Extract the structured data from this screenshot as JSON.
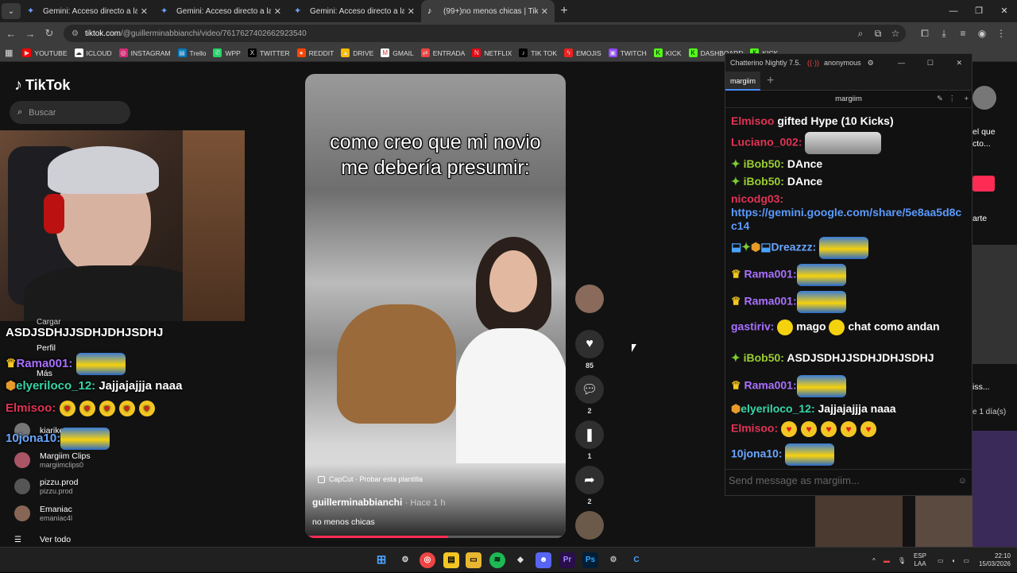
{
  "browser": {
    "tabs": [
      {
        "label": "Gemini: Acceso directo a la IA c",
        "icon": "gemini-icon"
      },
      {
        "label": "Gemini: Acceso directo a la IA c",
        "icon": "gemini-icon"
      },
      {
        "label": "Gemini: Acceso directo a la IA c",
        "icon": "gemini-icon"
      },
      {
        "label": "(99+)no menos chicas | TikTok",
        "icon": "tiktok-icon"
      }
    ],
    "url_domain": "tiktok.com",
    "url_path": "/@guillerminabbianchi/video/7617627402662923540",
    "bookmarks": [
      "YOUTUBE",
      "ICLOUD",
      "INSTAGRAM",
      "Trello",
      "WPP",
      "TWITTER",
      "REDDIT",
      "DRIVE",
      "GMAIL",
      "ENTRADA",
      "NETFLIX",
      "TIK TOK",
      "EMOJIS",
      "TWITCH",
      "KICK",
      "DASHBOARD",
      "KICK"
    ],
    "accent": "#4a8cff"
  },
  "tiktok": {
    "logo": "TikTok",
    "search_placeholder": "Buscar",
    "video": {
      "caption_line1": "como creo que mi novio",
      "caption_line2": "me debería presumir:",
      "capcut": "CapCut · Probar esta plantilla",
      "author": "guillerminabbianchi",
      "time": "· Hace 1 h",
      "description": "no menos chicas",
      "progress": 0.55
    },
    "actions": {
      "likes": "85",
      "comments": "2",
      "saves": "1",
      "shares": "2"
    },
    "sidebar": {
      "cargar": "Cargar",
      "perfil": "Perfil",
      "mas": "Más",
      "following": [
        {
          "name": "kiarike",
          "handle": ""
        },
        {
          "name": "Margiim Clips",
          "handle": "margiimclips0"
        },
        {
          "name": "pizzu.prod",
          "handle": "pizzu.prod"
        },
        {
          "name": "Emaniac",
          "handle": "emaniac4l"
        }
      ],
      "ver_todo": "Ver todo"
    },
    "overlay_chat": [
      {
        "user": "",
        "text": "ASDJSDHJJSDHJDHJSDHJ",
        "color": "#ffffff"
      },
      {
        "user": "Rama001:",
        "text": "",
        "color": "#a970ff"
      },
      {
        "user": "elyeriloco_12:",
        "text": "Jajjajajjja naaa",
        "color": "#36d6a8"
      },
      {
        "user": "Elmisoo:",
        "text": "",
        "color": "#e03355"
      },
      {
        "user": "10jona10:",
        "text": "",
        "color": "#6aa6ff"
      }
    ]
  },
  "chatterino": {
    "title": "Chatterino Nightly 7.5.",
    "account": "anonymous",
    "tab": "margiim",
    "channel": "margiim",
    "messages": [
      {
        "user": "Elmisoo",
        "text": "gifted Hype (10 Kicks)",
        "color": "#e03355"
      },
      {
        "user": "Luciano_002:",
        "text": "",
        "color": "#e03355"
      },
      {
        "user": "iBob50:",
        "text": "DAnce",
        "color": "#9acd32"
      },
      {
        "user": "iBob50:",
        "text": "DAnce",
        "color": "#9acd32"
      },
      {
        "user": "nicodg03:",
        "text": "https://gemini.google.com/share/5e8aa5d8cc14",
        "color": "#e03355"
      },
      {
        "user": "Dreazzz:",
        "text": "",
        "color": "#6aa6ff"
      },
      {
        "user": "Rama001:",
        "text": "",
        "color": "#a970ff"
      },
      {
        "user": "Rama001:",
        "text": "",
        "color": "#a970ff"
      },
      {
        "user": "gastiriv:",
        "text": "mago",
        "text2": "chat como andan",
        "color": "#a970ff"
      },
      {
        "user": "iBob50:",
        "text": "ASDJSDHJJSDHJDHJSDHJ",
        "color": "#9acd32"
      },
      {
        "user": "Rama001:",
        "text": "",
        "color": "#a970ff"
      },
      {
        "user": "elyeriloco_12:",
        "text": "Jajjajajjja naaa",
        "color": "#36d6a8"
      },
      {
        "user": "Elmisoo:",
        "text": "",
        "color": "#e03355"
      },
      {
        "user": "10jona10:",
        "text": "",
        "color": "#6aa6ff"
      }
    ],
    "input_placeholder": "Send message as margiim...",
    "link_color": "#5a9bff"
  },
  "right_panel": {
    "snippet1": "el que",
    "snippet2": "cto...",
    "snippet3": "arte",
    "snippet4": "iss...",
    "snippet5": "e 1 día(s)"
  },
  "taskbar": {
    "lang": "ESP",
    "lang2": "LAA",
    "time": "22:10",
    "date": "15/03/2026"
  }
}
